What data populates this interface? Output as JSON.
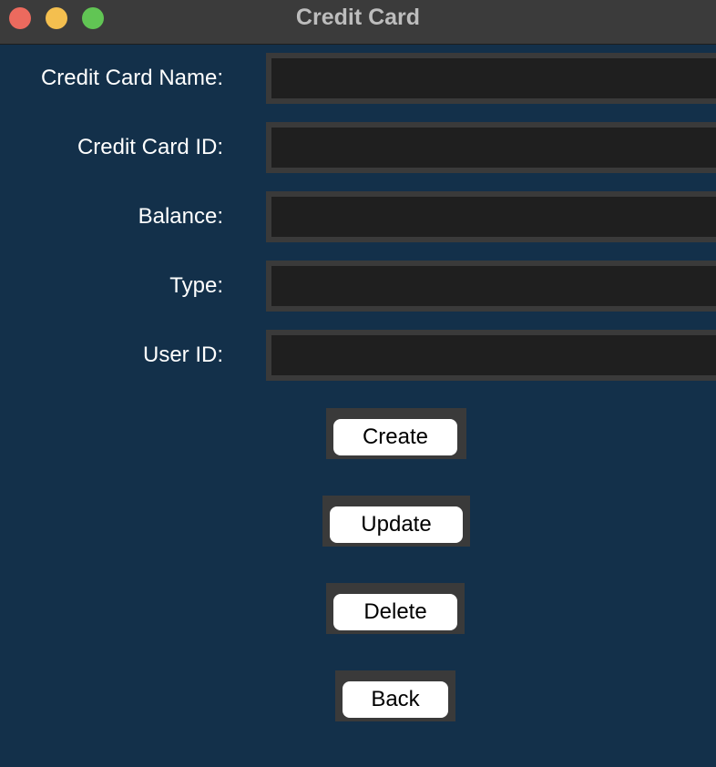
{
  "window": {
    "title": "Credit Card"
  },
  "form": {
    "fields": [
      {
        "label": "Credit Card Name:",
        "value": "",
        "placeholder": ""
      },
      {
        "label": "Credit Card ID:",
        "value": "",
        "placeholder": ""
      },
      {
        "label": "Balance:",
        "value": "",
        "placeholder": ""
      },
      {
        "label": "Type:",
        "value": "",
        "placeholder": ""
      },
      {
        "label": "User ID:",
        "value": "",
        "placeholder": ""
      }
    ]
  },
  "actions": {
    "create_label": "Create",
    "update_label": "Update",
    "delete_label": "Delete",
    "back_label": "Back"
  },
  "colors": {
    "background": "#13304a",
    "titlebar": "#3b3b3b",
    "field_background": "#1f1f1f",
    "field_border": "#3a3a3a",
    "button_background": "#ffffff",
    "close": "#ec6a5e",
    "minimize": "#f4bf4f",
    "zoom": "#61c554"
  }
}
